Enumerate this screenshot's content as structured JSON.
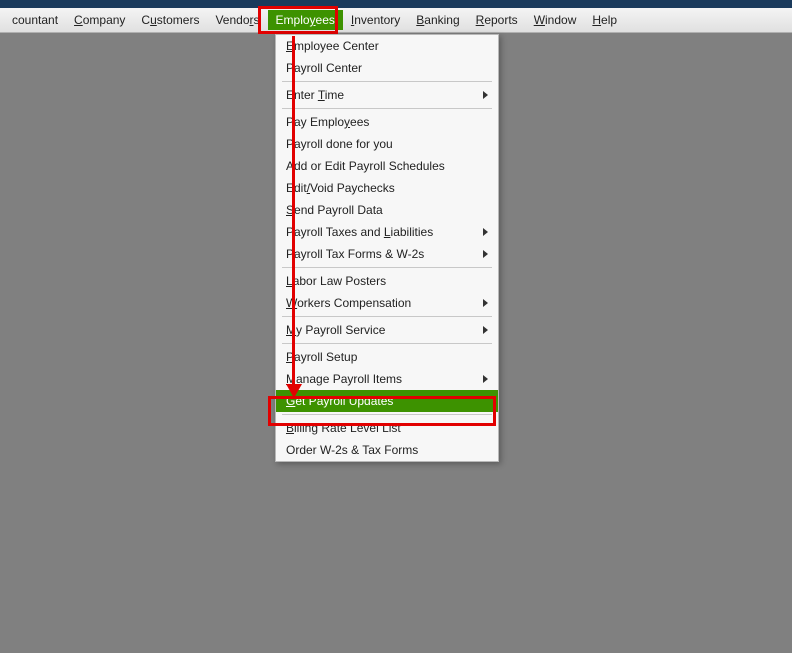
{
  "menubar": {
    "items": [
      {
        "label": "countant",
        "u": -1
      },
      {
        "label": "Company",
        "u": 0
      },
      {
        "label": "Customers",
        "u": 1
      },
      {
        "label": "Vendors",
        "u": 5
      },
      {
        "label": "Employees",
        "u": 5,
        "active": true
      },
      {
        "label": "Inventory",
        "u": 0
      },
      {
        "label": "Banking",
        "u": 0
      },
      {
        "label": "Reports",
        "u": 0
      },
      {
        "label": "Window",
        "u": 0
      },
      {
        "label": "Help",
        "u": 0
      }
    ]
  },
  "dropdown": {
    "groups": [
      [
        {
          "label": "Employee Center",
          "u": 0
        },
        {
          "label": "Payroll Center",
          "u": -1
        }
      ],
      [
        {
          "label": "Enter Time",
          "u": 6,
          "submenu": true
        }
      ],
      [
        {
          "label": "Pay Employees",
          "u": 9
        },
        {
          "label": "Payroll done for you",
          "u": -1
        },
        {
          "label": "Add or Edit Payroll Schedules",
          "u": -1
        },
        {
          "label": "Edit/Void Paychecks",
          "u": 4
        },
        {
          "label": "Send Payroll Data",
          "u": 0
        },
        {
          "label": "Payroll Taxes and Liabilities",
          "u": 18,
          "submenu": true
        },
        {
          "label": "Payroll Tax Forms & W-2s",
          "u": -1,
          "submenu": true
        }
      ],
      [
        {
          "label": "Labor Law Posters",
          "u": 0
        },
        {
          "label": "Workers Compensation",
          "u": 0,
          "submenu": true
        }
      ],
      [
        {
          "label": "My Payroll Service",
          "u": 0,
          "submenu": true
        }
      ],
      [
        {
          "label": "Payroll Setup",
          "u": 0
        },
        {
          "label": "Manage Payroll Items",
          "u": 0,
          "submenu": true
        },
        {
          "label": "Get Payroll Updates",
          "u": 0,
          "selected": true
        }
      ],
      [
        {
          "label": "Billing Rate Level List",
          "u": 0
        },
        {
          "label": "Order W-2s & Tax Forms",
          "u": -1
        }
      ]
    ]
  }
}
